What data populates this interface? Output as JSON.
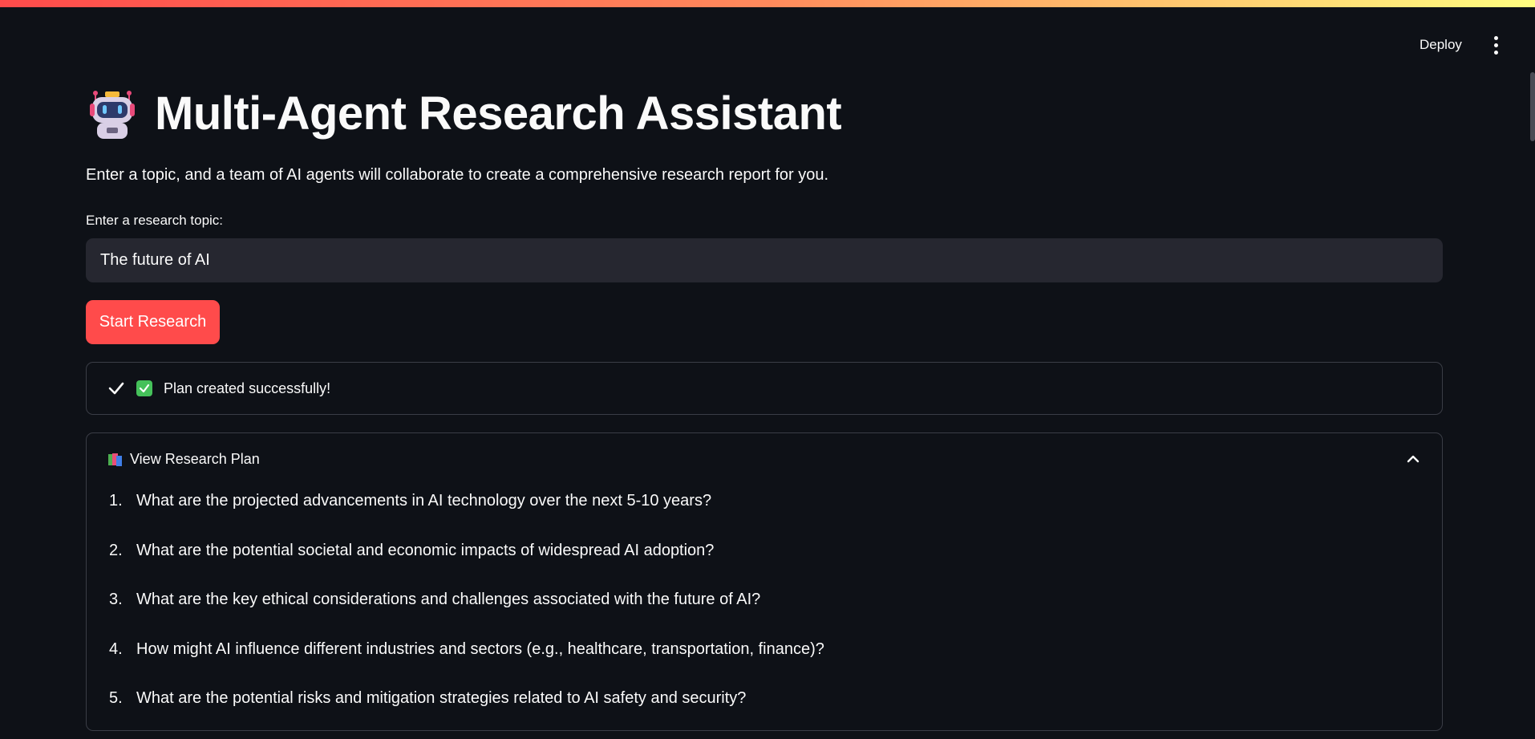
{
  "header": {
    "deploy_label": "Deploy"
  },
  "app": {
    "title": "Multi-Agent Research Assistant",
    "subtitle": "Enter a topic, and a team of AI agents will collaborate to create a comprehensive research report for you.",
    "title_icon": "robot-icon"
  },
  "form": {
    "topic_label": "Enter a research topic:",
    "topic_value": "The future of AI",
    "start_button_label": "Start Research"
  },
  "status": {
    "message": "Plan created successfully!",
    "icons": [
      "check-icon",
      "green-check-emoji-icon"
    ]
  },
  "expander": {
    "title": "View Research Plan",
    "icon": "books-icon",
    "expanded": true,
    "items": [
      {
        "num": "1.",
        "text": "What are the projected advancements in AI technology over the next 5-10 years?"
      },
      {
        "num": "2.",
        "text": "What are the potential societal and economic impacts of widespread AI adoption?"
      },
      {
        "num": "3.",
        "text": "What are the key ethical considerations and challenges associated with the future of AI?"
      },
      {
        "num": "4.",
        "text": "How might AI influence different industries and sectors (e.g., healthcare, transportation, finance)?"
      },
      {
        "num": "5.",
        "text": "What are the potential risks and mitigation strategies related to AI safety and security?"
      }
    ]
  },
  "colors": {
    "background": "#0e1117",
    "accent": "#ff4b4b",
    "input_bg": "#262730",
    "border": "#3a3d46",
    "success": "#45c15a"
  }
}
